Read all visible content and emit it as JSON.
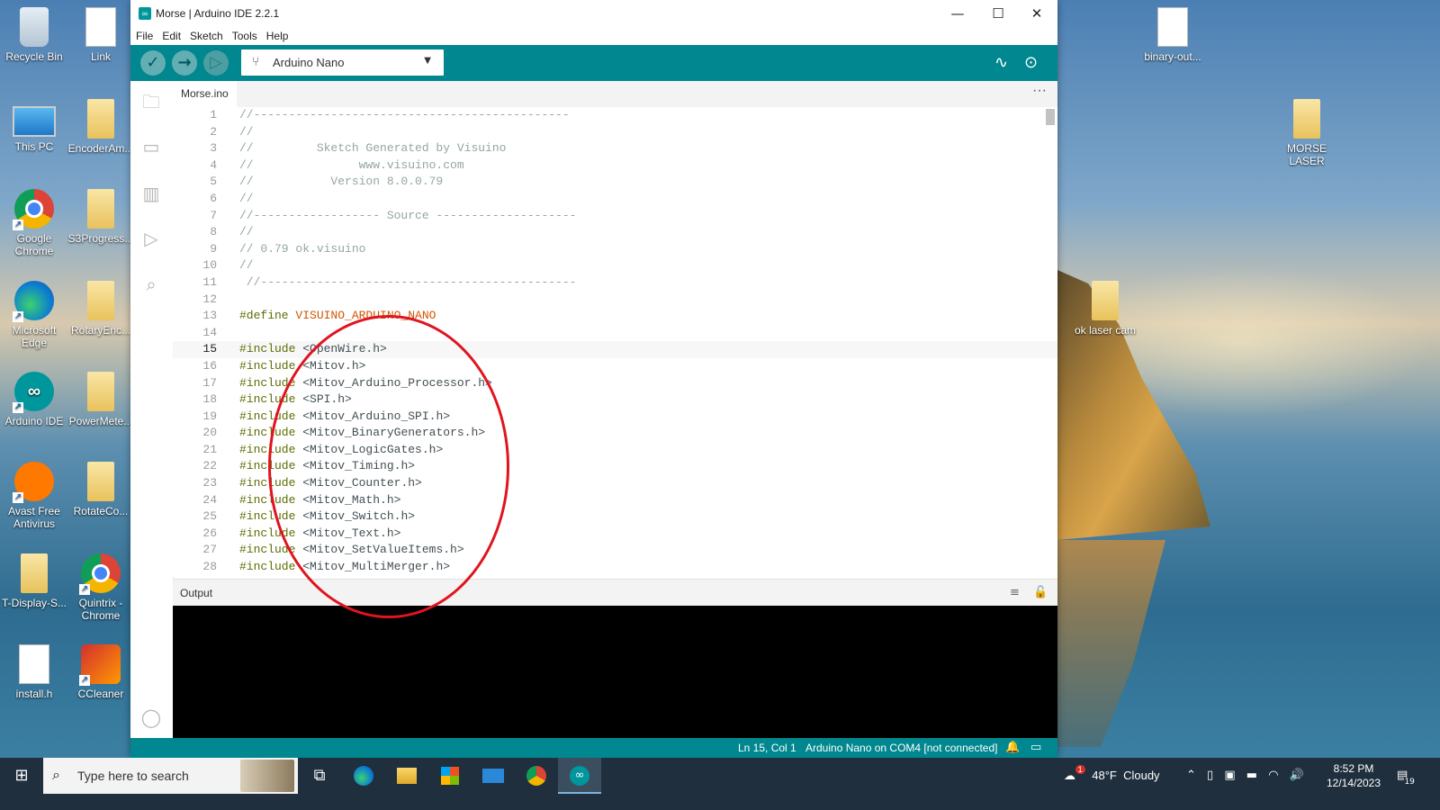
{
  "desktop": {
    "icons": [
      {
        "label": "Recycle Bin",
        "icon": "recycle-bin-icon"
      },
      {
        "label": "Link",
        "icon": "file-icon"
      },
      {
        "label": "This PC",
        "icon": "this-pc-icon"
      },
      {
        "label": "EncoderAm...",
        "icon": "folder-icon"
      },
      {
        "label": "Google Chrome",
        "icon": "chrome-icon"
      },
      {
        "label": "S3Progress...",
        "icon": "arduino-file-icon"
      },
      {
        "label": "Microsoft Edge",
        "icon": "edge-icon"
      },
      {
        "label": "RotaryEnc...",
        "icon": "folder-icon"
      },
      {
        "label": "Arduino IDE",
        "icon": "arduino-icon"
      },
      {
        "label": "PowerMete...",
        "icon": "folder-icon"
      },
      {
        "label": "Avast Free Antivirus",
        "icon": "avast-icon"
      },
      {
        "label": "RotateCo...",
        "icon": "folder-icon"
      },
      {
        "label": "T-Display-S...",
        "icon": "folder-icon"
      },
      {
        "label": "Quintrix - Chrome",
        "icon": "chrome-icon"
      },
      {
        "label": "install.h",
        "icon": "file-icon"
      },
      {
        "label": "CCleaner",
        "icon": "ccleaner-icon"
      },
      {
        "label": "binary-out...",
        "icon": "file-icon"
      },
      {
        "label": "MORSE LASER",
        "icon": "arduino-folder-icon"
      },
      {
        "label": "ok laser cam",
        "icon": "folder-icon"
      }
    ]
  },
  "window": {
    "title": "Morse | Arduino IDE 2.2.1",
    "controls": {
      "minimize": "—",
      "maximize": "☐",
      "close": "✕"
    }
  },
  "menu": [
    "File",
    "Edit",
    "Sketch",
    "Tools",
    "Help"
  ],
  "toolbar": {
    "verify_icon": "✓",
    "upload_icon": "→",
    "debug_icon": "▷",
    "board": "Arduino Nano",
    "plotter_icon": "∿",
    "monitor_icon": "⊙"
  },
  "tabs": [
    {
      "label": "Morse.ino",
      "active": true
    }
  ],
  "tab_more": "···",
  "editor": {
    "active_line": 15,
    "lines": [
      {
        "n": 1,
        "text": "//---------------------------------------------",
        "type": "comment"
      },
      {
        "n": 2,
        "text": "//",
        "type": "comment"
      },
      {
        "n": 3,
        "text": "//         Sketch Generated by Visuino",
        "type": "comment"
      },
      {
        "n": 4,
        "text": "//               www.visuino.com",
        "type": "comment"
      },
      {
        "n": 5,
        "text": "//           Version 8.0.0.79",
        "type": "comment"
      },
      {
        "n": 6,
        "text": "//",
        "type": "comment"
      },
      {
        "n": 7,
        "text": "//------------------ Source --------------------",
        "type": "comment"
      },
      {
        "n": 8,
        "text": "//",
        "type": "comment"
      },
      {
        "n": 9,
        "text": "// 0.79 ok.visuino",
        "type": "comment"
      },
      {
        "n": 10,
        "text": "//",
        "type": "comment"
      },
      {
        "n": 11,
        "text": " //---------------------------------------------",
        "type": "comment"
      },
      {
        "n": 12,
        "text": "",
        "type": "plain"
      },
      {
        "n": 13,
        "pre": "#define",
        "rest": " VISUINO_ARDUINO_NANO",
        "type": "define"
      },
      {
        "n": 14,
        "text": "",
        "type": "plain"
      },
      {
        "n": 15,
        "pre": "#include",
        "rest": " <OpenWire.h>",
        "type": "include"
      },
      {
        "n": 16,
        "pre": "#include",
        "rest": " <Mitov.h>",
        "type": "include"
      },
      {
        "n": 17,
        "pre": "#include",
        "rest": " <Mitov_Arduino_Processor.h>",
        "type": "include"
      },
      {
        "n": 18,
        "pre": "#include",
        "rest": " <SPI.h>",
        "type": "include"
      },
      {
        "n": 19,
        "pre": "#include",
        "rest": " <Mitov_Arduino_SPI.h>",
        "type": "include"
      },
      {
        "n": 20,
        "pre": "#include",
        "rest": " <Mitov_BinaryGenerators.h>",
        "type": "include"
      },
      {
        "n": 21,
        "pre": "#include",
        "rest": " <Mitov_LogicGates.h>",
        "type": "include"
      },
      {
        "n": 22,
        "pre": "#include",
        "rest": " <Mitov_Timing.h>",
        "type": "include"
      },
      {
        "n": 23,
        "pre": "#include",
        "rest": " <Mitov_Counter.h>",
        "type": "include"
      },
      {
        "n": 24,
        "pre": "#include",
        "rest": " <Mitov_Math.h>",
        "type": "include"
      },
      {
        "n": 25,
        "pre": "#include",
        "rest": " <Mitov_Switch.h>",
        "type": "include"
      },
      {
        "n": 26,
        "pre": "#include",
        "rest": " <Mitov_Text.h>",
        "type": "include"
      },
      {
        "n": 27,
        "pre": "#include",
        "rest": " <Mitov_SetValueItems.h>",
        "type": "include"
      },
      {
        "n": 28,
        "pre": "#include",
        "rest": " <Mitov_MultiMerger.h>",
        "type": "include"
      }
    ]
  },
  "output": {
    "label": "Output",
    "clear_icon": "≡",
    "lock_icon": "🔓"
  },
  "statusbar": {
    "position": "Ln 15, Col 1",
    "board_port": "Arduino Nano on COM4 [not connected]",
    "bell_icon": "🔔",
    "panel_icon": "▭"
  },
  "taskbar": {
    "search_placeholder": "Type here to search",
    "weather": "48°F  Cloudy",
    "weather_badge": "1",
    "time": "8:52 PM",
    "date": "12/14/2023",
    "notifications": "19",
    "apps": [
      "task-view-icon",
      "edge-icon",
      "file-explorer-icon",
      "store-icon",
      "mail-icon",
      "chrome-icon",
      "arduino-icon"
    ]
  },
  "colors": {
    "accent": "#00878f",
    "annotation": "#e0141e",
    "comment": "#95a5a6",
    "preprocessor": "#5e6d03",
    "macro": "#d35400"
  }
}
